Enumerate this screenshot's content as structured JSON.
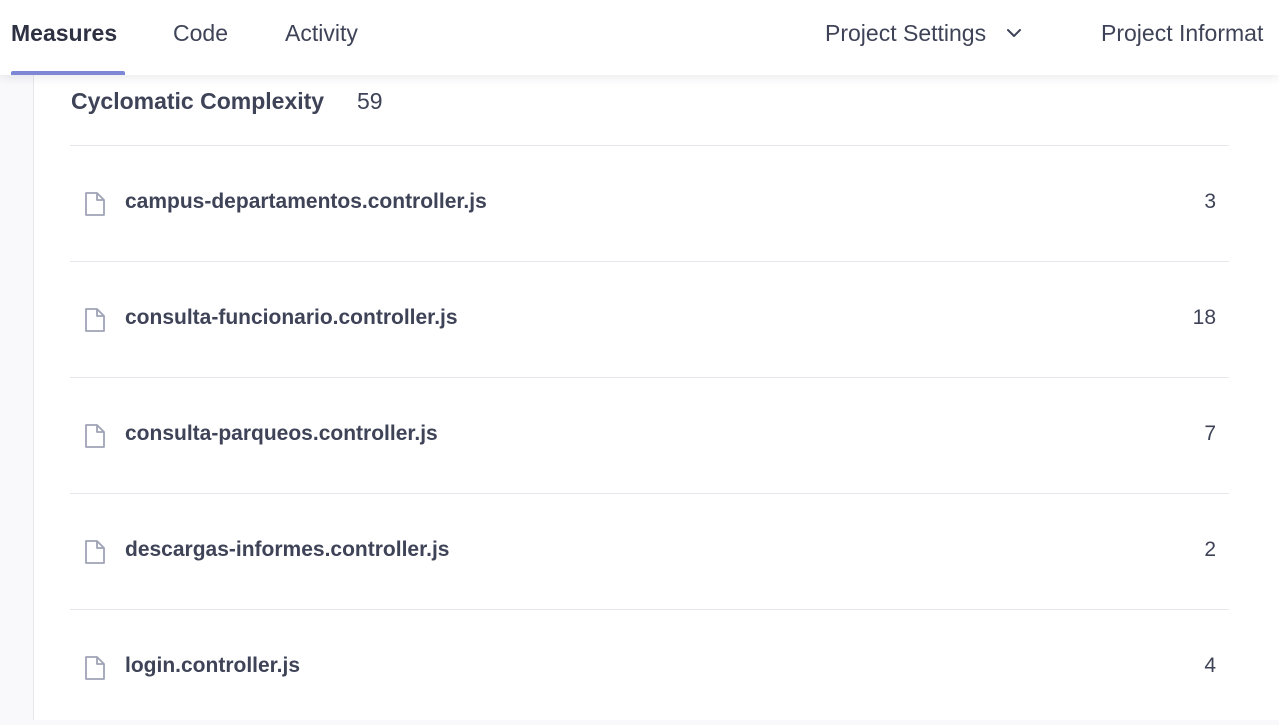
{
  "nav": {
    "tabs": [
      {
        "label": "Measures",
        "active": true
      },
      {
        "label": "Code",
        "active": false
      },
      {
        "label": "Activity",
        "active": false
      }
    ],
    "settings_label": "Project Settings",
    "info_label": "Project Informat"
  },
  "measure": {
    "title": "Cyclomatic Complexity",
    "value": "59"
  },
  "files": [
    {
      "name": "campus-departamentos.controller.js",
      "value": "3",
      "icon": "file-icon"
    },
    {
      "name": "consulta-funcionario.controller.js",
      "value": "18",
      "icon": "file-icon"
    },
    {
      "name": "consulta-parqueos.controller.js",
      "value": "7",
      "icon": "file-icon"
    },
    {
      "name": "descargas-informes.controller.js",
      "value": "2",
      "icon": "file-icon"
    },
    {
      "name": "login.controller.js",
      "value": "4",
      "icon": "file-icon"
    }
  ],
  "colors": {
    "accent": "#7d87d6",
    "text": "#3e4357",
    "divider": "#e6e7ec"
  }
}
